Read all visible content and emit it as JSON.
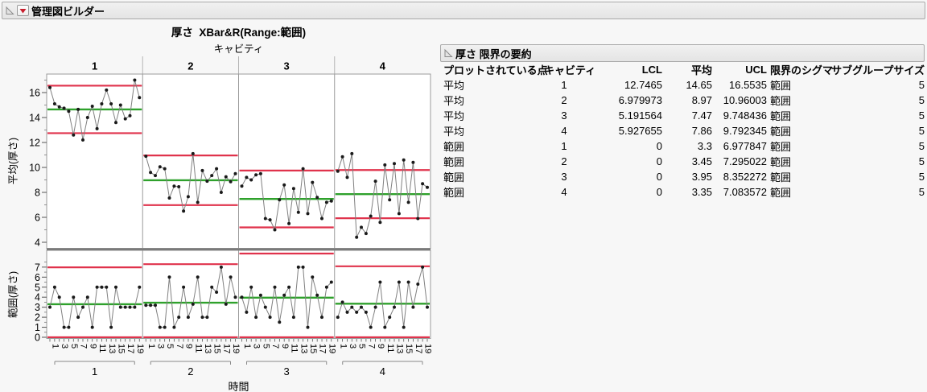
{
  "header": {
    "title": "管理図ビルダー"
  },
  "colors": {
    "limit_line": "#e0334c",
    "center_line": "#2fa12c",
    "series_line": "#808080",
    "marker": "#1a1a1a",
    "red_triangle": "#c81e2d",
    "panel_border": "#9b9b9b",
    "divider": "#7a7a7a"
  },
  "chart_data": {
    "type": "line",
    "title": "厚さ  XBar&R(Range:範囲)",
    "phase_axis_label": "キャビティ",
    "phases": [
      "1",
      "2",
      "3",
      "4"
    ],
    "xlabel": "時間",
    "x_tick_labels": [
      "1",
      "3",
      "5",
      "7",
      "9",
      "11",
      "13",
      "15",
      "17",
      "19"
    ],
    "points_per_panel": 20,
    "mean_chart": {
      "ylabel": "平均(厚さ)",
      "yticks": [
        4,
        6,
        8,
        10,
        12,
        14,
        16
      ],
      "minor_ticks": [
        5,
        7,
        9,
        11,
        13,
        15,
        17
      ],
      "ylim": [
        2.6,
        17.5
      ],
      "panels": [
        {
          "phase": "1",
          "lcl": 12.7465,
          "cl": 14.65,
          "ucl": 16.5535,
          "values": [
            16.4,
            15.1,
            14.85,
            14.75,
            14.5,
            12.6,
            14.65,
            12.2,
            14.0,
            14.9,
            13.1,
            15.1,
            16.2,
            15.1,
            13.6,
            15.0,
            13.9,
            14.15,
            17.0,
            15.6
          ]
        },
        {
          "phase": "2",
          "lcl": 6.979973,
          "cl": 8.97,
          "ucl": 10.96003,
          "values": [
            10.9,
            9.6,
            9.35,
            10.05,
            9.9,
            7.55,
            8.5,
            8.45,
            6.5,
            7.65,
            11.1,
            7.2,
            9.75,
            8.9,
            9.35,
            9.9,
            8.0,
            9.25,
            8.85,
            9.5
          ]
        },
        {
          "phase": "3",
          "lcl": 5.191564,
          "cl": 7.47,
          "ucl": 9.748436,
          "values": [
            8.5,
            9.2,
            9.0,
            9.4,
            9.5,
            5.9,
            5.8,
            5.0,
            7.4,
            8.6,
            5.5,
            8.3,
            6.4,
            9.9,
            6.3,
            8.8,
            7.6,
            5.9,
            7.2,
            7.3
          ]
        },
        {
          "phase": "4",
          "lcl": 5.927655,
          "cl": 7.86,
          "ucl": 9.792345,
          "values": [
            9.7,
            10.85,
            9.2,
            11.1,
            4.4,
            5.2,
            4.7,
            6.1,
            8.9,
            5.6,
            10.2,
            7.4,
            10.3,
            6.3,
            10.6,
            7.2,
            10.4,
            5.9,
            8.7,
            8.4
          ]
        }
      ]
    },
    "range_chart": {
      "ylabel": "範囲(厚さ)",
      "yticks": [
        0,
        1,
        2,
        3,
        4,
        5,
        6,
        7
      ],
      "minor_ticks": [
        0.5,
        1.5,
        2.5,
        3.5,
        4.5,
        5.5,
        6.5,
        7.5
      ],
      "ylim": [
        -0.15,
        8.8
      ],
      "panels": [
        {
          "phase": "1",
          "lcl": 0,
          "cl": 3.3,
          "ucl": 6.977847,
          "values": [
            3,
            5,
            4,
            1,
            1,
            4,
            2,
            3,
            4,
            1,
            5,
            5,
            5,
            1,
            5,
            3,
            3,
            3,
            3,
            5
          ]
        },
        {
          "phase": "2",
          "lcl": 0,
          "cl": 3.45,
          "ucl": 7.295022,
          "values": [
            3.2,
            3.2,
            3.2,
            1,
            1,
            6,
            1,
            2,
            5,
            2,
            3.3,
            6,
            2,
            2,
            5,
            4.5,
            7,
            3.3,
            6,
            4
          ]
        },
        {
          "phase": "3",
          "lcl": 0,
          "cl": 3.95,
          "ucl": 8.352272,
          "values": [
            4,
            2.5,
            5,
            2,
            4.2,
            3,
            2,
            5,
            1.5,
            4.2,
            5,
            2,
            7,
            7,
            1,
            6,
            4.2,
            2,
            5,
            5.5
          ]
        },
        {
          "phase": "4",
          "lcl": 0,
          "cl": 3.35,
          "ucl": 7.083572,
          "values": [
            2,
            3.5,
            2.5,
            3,
            2.5,
            3,
            2.5,
            1,
            3,
            5.5,
            1,
            2,
            3,
            5.5,
            1,
            5.5,
            3,
            5.3,
            7,
            3
          ]
        }
      ]
    }
  },
  "table": {
    "title": "厚さ 限界の要約",
    "columns": [
      "プロットされている点",
      "キャビティ",
      "LCL",
      "平均",
      "UCL",
      "限界のシグマ",
      "サブグループサイズ"
    ],
    "rows": [
      [
        "平均",
        "1",
        "12.7465",
        "14.65",
        "16.5535",
        "範囲",
        "5"
      ],
      [
        "平均",
        "2",
        "6.979973",
        "8.97",
        "10.96003",
        "範囲",
        "5"
      ],
      [
        "平均",
        "3",
        "5.191564",
        "7.47",
        "9.748436",
        "範囲",
        "5"
      ],
      [
        "平均",
        "4",
        "5.927655",
        "7.86",
        "9.792345",
        "範囲",
        "5"
      ],
      [
        "範囲",
        "1",
        "0",
        "3.3",
        "6.977847",
        "範囲",
        "5"
      ],
      [
        "範囲",
        "2",
        "0",
        "3.45",
        "7.295022",
        "範囲",
        "5"
      ],
      [
        "範囲",
        "3",
        "0",
        "3.95",
        "8.352272",
        "範囲",
        "5"
      ],
      [
        "範囲",
        "4",
        "0",
        "3.35",
        "7.083572",
        "範囲",
        "5"
      ]
    ]
  }
}
